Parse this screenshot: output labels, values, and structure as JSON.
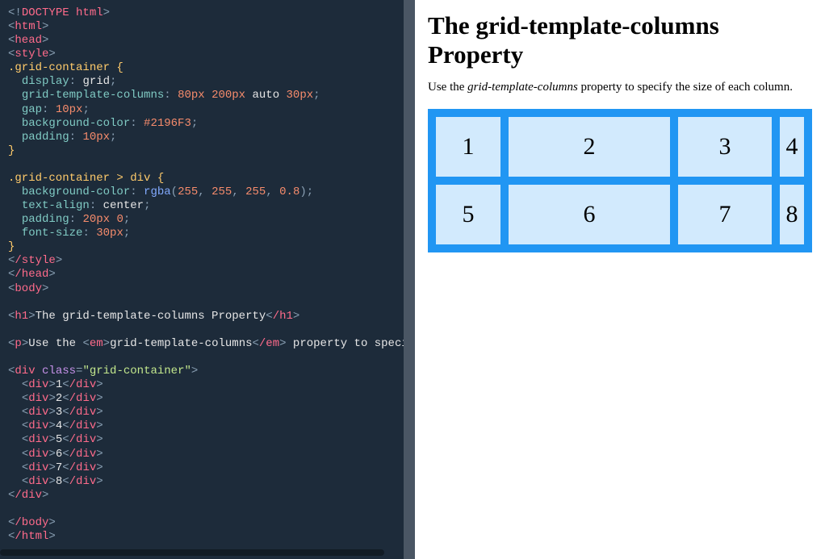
{
  "code": {
    "doctype": "<!DOCTYPE html>",
    "open_html": "html",
    "open_head": "head",
    "open_style": "style",
    "sel1": ".grid-container {",
    "p1": "display",
    "v1": "grid",
    "p2": "grid-template-columns",
    "v2a": "80px",
    "v2b": "200px",
    "v2c": "auto",
    "v2d": "30px",
    "p3": "gap",
    "v3": "10px",
    "p4": "background-color",
    "v4": "#2196F3",
    "p5": "padding",
    "v5": "10px",
    "close1": "}",
    "sel2": ".grid-container > div {",
    "p6": "background-color",
    "v6func": "rgba",
    "v6a": "255",
    "v6b": "255",
    "v6c": "255",
    "v6d": "0.8",
    "p7": "text-align",
    "v7": "center",
    "p8": "padding",
    "v8a": "20px",
    "v8b": "0",
    "p9": "font-size",
    "v9": "30px",
    "close2": "}",
    "close_style": "/style",
    "close_head": "/head",
    "open_body": "body",
    "h1tag": "h1",
    "h1text": "The grid-template-columns Property",
    "h1close": "/h1",
    "ptag": "p",
    "ptext1": "Use the ",
    "emtag": "em",
    "emtext": "grid-template-columns",
    "emclose": "/em",
    "ptext2": " property to specify the size of each column.",
    "pclose": "/p",
    "divtag": "div",
    "attr_class": "class",
    "attr_val": "\"grid-container\"",
    "cells": [
      "1",
      "2",
      "3",
      "4",
      "5",
      "6",
      "7",
      "8"
    ],
    "divclose": "/div",
    "close_body": "/body",
    "close_html": "/html"
  },
  "preview": {
    "heading": "The grid-template-columns Property",
    "para_pre": "Use the ",
    "para_em": "grid-template-columns",
    "para_post": " property to specify the size of each column.",
    "cells": [
      "1",
      "2",
      "3",
      "4",
      "5",
      "6",
      "7",
      "8"
    ]
  }
}
